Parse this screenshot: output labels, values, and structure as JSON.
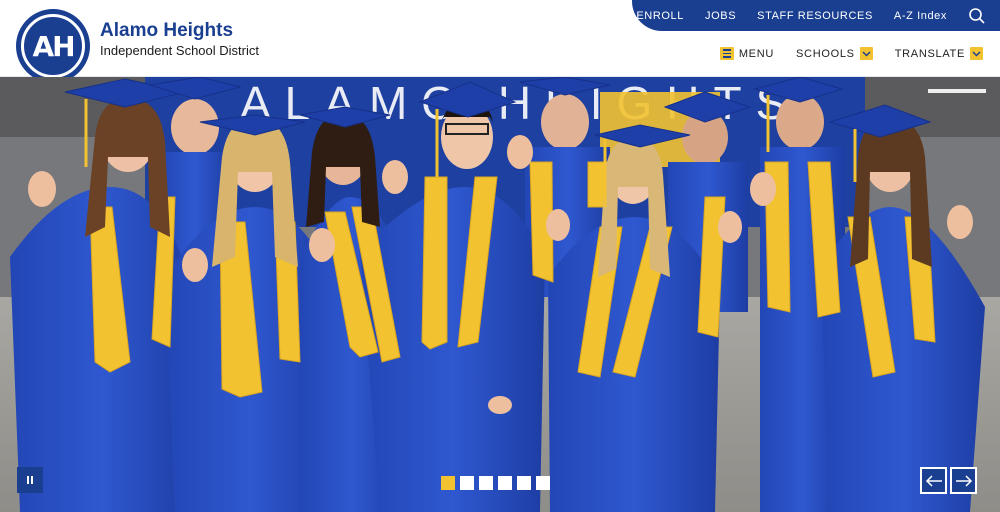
{
  "logo": {
    "initials": "AH"
  },
  "district": {
    "name": "Alamo Heights",
    "subtitle": "Independent School District"
  },
  "utility_links": [
    "ENROLL",
    "JOBS",
    "STAFF RESOURCES",
    "A-Z Index"
  ],
  "nav": {
    "menu": "MENU",
    "schools": "SCHOOLS",
    "translate": "TRANSLATE"
  },
  "hero": {
    "banner_text": "ALAMO HEIGHTS"
  },
  "carousel": {
    "slide_count": 6,
    "active_slide": 1
  },
  "colors": {
    "primary": "#1a3f91",
    "accent": "#f2c230",
    "gown": "#2346b8"
  },
  "icons": [
    "search-icon",
    "menu-icon",
    "chevron-down-icon",
    "pause-icon",
    "arrow-left-icon",
    "arrow-right-icon"
  ]
}
